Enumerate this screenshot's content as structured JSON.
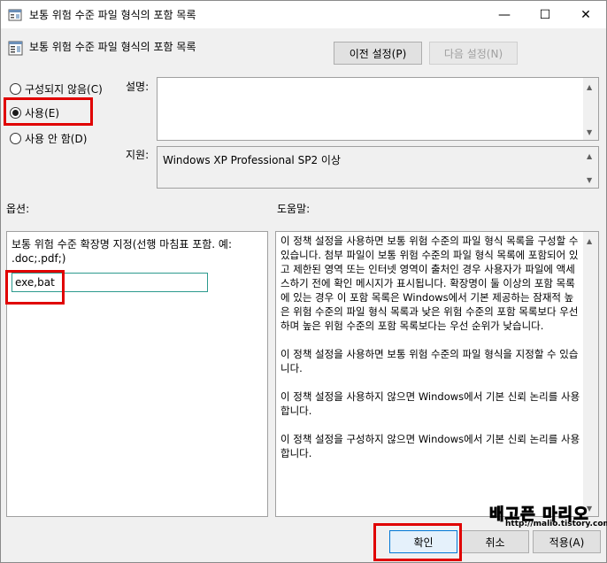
{
  "window": {
    "title": "보통 위험 수준 파일 형식의 포함 목록",
    "minimize_glyph": "—",
    "maximize_glyph": "☐",
    "close_glyph": "✕"
  },
  "header": {
    "policy_title": "보통 위험 수준 파일 형식의 포함 목록",
    "prev_label": "이전 설정(P)",
    "next_label": "다음 설정(N)"
  },
  "state": {
    "options": [
      {
        "label": "구성되지 않음(C)",
        "selected": false
      },
      {
        "label": "사용(E)",
        "selected": true
      },
      {
        "label": "사용 안 함(D)",
        "selected": false
      }
    ]
  },
  "comment": {
    "label": "설명:",
    "value": ""
  },
  "supported": {
    "label": "지원:",
    "value": "Windows XP Professional SP2 이상"
  },
  "options_panel": {
    "label": "옵션:",
    "description": "보통 위험 수준 확장명 지정(선행 마침표 포함. 예: .doc;.pdf;)",
    "extensions_value": "exe,bat"
  },
  "help_panel": {
    "label": "도움말:",
    "paragraphs": [
      "이 정책 설정을 사용하면 보통 위험 수준의 파일 형식 목록을 구성할 수 있습니다. 첨부 파일이 보통 위험 수준의 파일 형식 목록에 포함되어 있고 제한된 영역 또는 인터넷 영역이 출처인 경우 사용자가 파일에 액세스하기 전에 확인 메시지가 표시됩니다. 확장명이 둘 이상의 포함 목록에 있는 경우 이 포함 목록은 Windows에서 기본 제공하는 잠재적 높은 위험 수준의 파일 형식 목록과 낮은 위험 수준의 포함 목록보다 우선하며 높은 위험 수준의 포함 목록보다는 우선 순위가 낮습니다.",
      "이 정책 설정을 사용하면 보통 위험 수준의 파일 형식을 지정할 수 있습니다.",
      "이 정책 설정을 사용하지 않으면 Windows에서 기본 신뢰 논리를 사용합니다.",
      "이 정책 설정을 구성하지 않으면 Windows에서 기본 신뢰 논리를 사용합니다."
    ]
  },
  "footer": {
    "ok_label": "확인",
    "cancel_label": "취소",
    "apply_label": "적용(A)"
  },
  "watermark": {
    "text": "배고픈 마리오",
    "url": "http://malio.tistory.com"
  },
  "colors": {
    "highlight_red": "#e00000",
    "input_border": "#2c9a8e",
    "watermark_yellow": "#ffd400"
  }
}
